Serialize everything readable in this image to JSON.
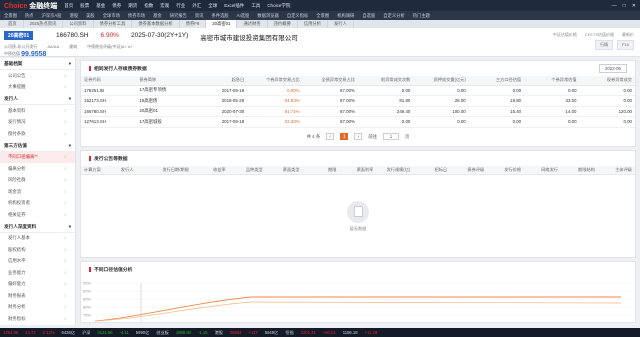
{
  "app": {
    "brand": "Choice",
    "brand_suffix": "金融终端"
  },
  "menu": [
    "首页",
    "股票",
    "基金",
    "债券",
    "期货",
    "指数",
    "宏观",
    "行业",
    "外汇",
    "全球",
    "Excel插件",
    "工具",
    "Choice学院"
  ],
  "toolbar": [
    "全景图",
    "热点",
    "沪深京A股",
    "港股",
    "美股",
    "全球市场",
    "债券市场",
    "基金",
    "研究报告",
    "资讯",
    "条件选股",
    "AI选股",
    "数据浏览器",
    "自定义指标",
    "全景图",
    "机构调研",
    "自选股",
    "自定义分析",
    "热门主题"
  ],
  "tabs": [
    "首页",
    "2025热点资讯",
    "公司资料",
    "债券分析工具",
    "债券基本数据分析",
    "债券F9",
    "20高密01",
    "通达财务",
    "违约概要",
    "信用分析",
    "发行人"
  ],
  "header": {
    "ticker": "20高密01",
    "code": "166780.SH",
    "coupon": "6.90%",
    "maturity": "2025-07-30(2Y+1Y)",
    "issuer": "高密市城市建设投资集团有限公司",
    "type_label": "公司债-非公开发行",
    "rating_label": "评级AA",
    "grade": "AA/AA",
    "industry": "建筑",
    "price_label": "中债估值",
    "price_value": "99.9558",
    "ratings": "中债隐含评级(中证)A+ A+",
    "right_labels": [
      "中证估值价格",
      "CFETS估值价格",
      "最新价"
    ],
    "right_btns": [
      "行情",
      "F10"
    ]
  },
  "sidebar": [
    {
      "type": "group",
      "label": "基础档案"
    },
    {
      "type": "item",
      "label": "公司公告"
    },
    {
      "type": "item",
      "label": "大事提醒"
    },
    {
      "type": "group",
      "label": "发行人"
    },
    {
      "type": "item",
      "label": "基本资料"
    },
    {
      "type": "item",
      "label": "发行情况"
    },
    {
      "type": "item",
      "label": "偿付条款"
    },
    {
      "type": "group",
      "label": "第三方估值"
    },
    {
      "type": "item",
      "label": "不同口径偏离**",
      "hl": true
    },
    {
      "type": "item",
      "label": "偏离分析"
    },
    {
      "type": "item",
      "label": "风险社群"
    },
    {
      "type": "item",
      "label": "现金流"
    },
    {
      "type": "item",
      "label": "机构投资者"
    },
    {
      "type": "item",
      "label": "相关证券"
    },
    {
      "type": "group",
      "label": "发行人深度资料"
    },
    {
      "type": "item",
      "label": "发行人基本"
    },
    {
      "type": "item",
      "label": "股权结构"
    },
    {
      "type": "item",
      "label": "信用水平"
    },
    {
      "type": "item",
      "label": "业务能力"
    },
    {
      "type": "item",
      "label": "偏好能力"
    },
    {
      "type": "item",
      "label": "财务报表"
    },
    {
      "type": "item",
      "label": "财务分析"
    },
    {
      "type": "item",
      "label": "财务指标"
    },
    {
      "type": "item",
      "label": "经营状况"
    }
  ],
  "panel1": {
    "title": "相同发行人存续债券数据",
    "period": "2022-06",
    "columns": [
      "证券代码",
      "债券简称",
      "起息日",
      "个券异常交易占比",
      "全债异常交易占比",
      "前异常成交次数",
      "质押成交量(亿元)",
      "三方口径估值",
      "个券异常估值",
      "现券异常成交"
    ],
    "rows": [
      [
        "178251.IB",
        "17高密专项债",
        "2017-09-18",
        "0.00%",
        "87.00%",
        "0.00",
        "0.00",
        "0.00",
        "0.00",
        "0.00"
      ],
      [
        "152173.SH",
        "19高密债",
        "2019-05-29",
        "94.93%",
        "87.00%",
        "81.80",
        "28.00",
        "19.80",
        "33.00",
        "0.00"
      ],
      [
        "166780.SH",
        "20高密01",
        "2020-07-30",
        "91.71%",
        "87.00%",
        "249.40",
        "100.00",
        "15.40",
        "14.00",
        "120.00"
      ],
      [
        "127613.SH",
        "17高密城投",
        "2017-09-18",
        "33.33%",
        "87.00%",
        "0.00",
        "0.00",
        "0.00",
        "0.00",
        "0.00"
      ]
    ],
    "red_col": 3,
    "pager": {
      "total": "共 4 条",
      "current": "1",
      "goto_label": "前往",
      "goto_page": "1",
      "page_unit": "页"
    }
  },
  "panel2": {
    "title": "发行公告等数据",
    "columns": [
      "计算方案",
      "发行人",
      "发行日期/期限",
      "收益率",
      "品种类型",
      "票面类型",
      "期限",
      "票面利率",
      "发行规模(亿)",
      "招标日",
      "债券评级",
      "发行价格",
      "网络发行",
      "期限结构",
      "主体评级"
    ],
    "empty_text": "暂无数据"
  },
  "panel3": {
    "title": "不同口径估值分析",
    "yticks": [
      "95%",
      "90%",
      "85%",
      "80%",
      "75%",
      "70%"
    ]
  },
  "status": {
    "items": [
      {
        "t": "1253.96",
        "c": "up"
      },
      {
        "t": "14.72",
        "c": "up"
      },
      {
        "t": "0.12%",
        "c": "up"
      },
      {
        "t": "6436亿",
        "c": ""
      },
      {
        "t": "沪深",
        "c": ""
      },
      {
        "t": "3121.56",
        "c": "dn"
      },
      {
        "t": "-4.11",
        "c": "dn"
      },
      {
        "t": "5990亿",
        "c": ""
      },
      {
        "t": "创业板",
        "c": ""
      },
      {
        "t": "1888.84",
        "c": "dn"
      },
      {
        "t": "-1.15",
        "c": "dn"
      },
      {
        "t": "港股",
        "c": ""
      },
      {
        "t": "28654",
        "c": "up"
      },
      {
        "t": "+117",
        "c": "up"
      },
      {
        "t": "5949亿",
        "c": ""
      },
      {
        "t": "恒指",
        "c": ""
      },
      {
        "t": "2201.31",
        "c": "up"
      },
      {
        "t": "+60.01",
        "c": "up"
      },
      {
        "t": "1186.18",
        "c": ""
      },
      {
        "t": "+11.29",
        "c": "up"
      }
    ]
  }
}
